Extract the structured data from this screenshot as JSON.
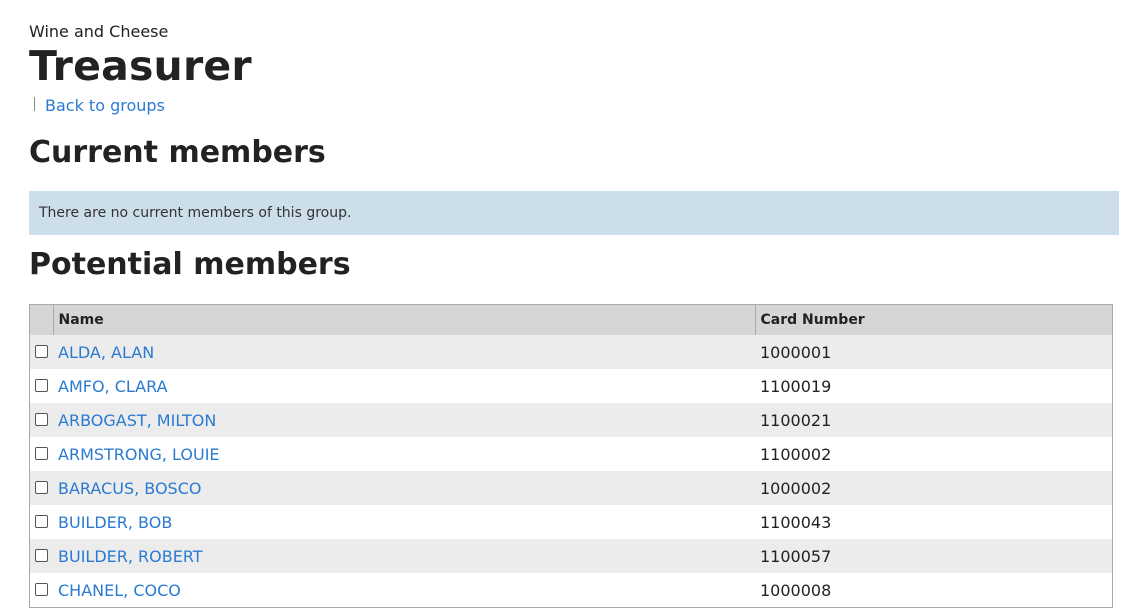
{
  "header": {
    "group_name": "Wine and Cheese",
    "title": "Treasurer",
    "back_link": "Back to groups"
  },
  "current_members": {
    "heading": "Current members",
    "empty_message": "There are no current members of this group."
  },
  "potential_members": {
    "heading": "Potential members",
    "columns": [
      "Name",
      "Card Number"
    ],
    "rows": [
      {
        "name": "ALDA, ALAN",
        "card": "1000001"
      },
      {
        "name": "AMFO, CLARA",
        "card": "1100019"
      },
      {
        "name": "ARBOGAST, MILTON",
        "card": "1100021"
      },
      {
        "name": "ARMSTRONG, LOUIE",
        "card": "1100002"
      },
      {
        "name": "BARACUS, BOSCO",
        "card": "1000002"
      },
      {
        "name": "BUILDER, BOB",
        "card": "1100043"
      },
      {
        "name": "BUILDER, ROBERT",
        "card": "1100057"
      },
      {
        "name": "CHANEL, COCO",
        "card": "1000008"
      }
    ]
  }
}
